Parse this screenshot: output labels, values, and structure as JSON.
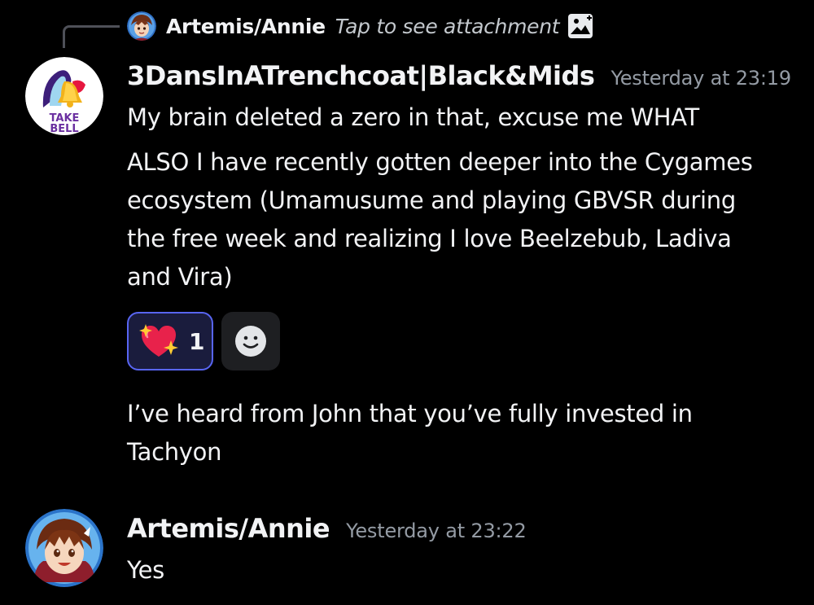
{
  "reply": {
    "author": "Artemis/Annie",
    "text": "Tap to see attachment",
    "icon": "image-icon"
  },
  "messages": [
    {
      "author": "3DansInATrenchcoat|Black&Mids",
      "timestamp": "Yesterday at 23:19",
      "avatar": "taco-bell-logo",
      "avatar_text": "TAKE BELL",
      "lines": [
        "My brain deleted a zero in that, excuse me WHAT",
        "ALSO I have recently gotten deeper into the Cygames ecosystem (Umamusume and playing GBVSR during the free week and realizing I love Beelzebub, Ladiva and Vira)",
        "I’ve heard from John that you’ve fully invested in Tachyon"
      ],
      "reactions": [
        {
          "emoji": "sparkling-heart",
          "count": "1",
          "active": true
        }
      ],
      "add_reaction_icon": "smiley-icon"
    },
    {
      "author": "Artemis/Annie",
      "timestamp": "Yesterday at 23:22",
      "avatar": "anime-girl-avatar",
      "lines": [
        "Yes",
        ""
      ]
    }
  ],
  "colors": {
    "background": "#000000",
    "text": "#f2f3f5",
    "muted": "#949ba4",
    "reaction_border": "#5865f2",
    "reaction_bg": "#1a1c3d",
    "add_reaction_bg": "#1e1f22",
    "reply_line": "#4e5058"
  }
}
